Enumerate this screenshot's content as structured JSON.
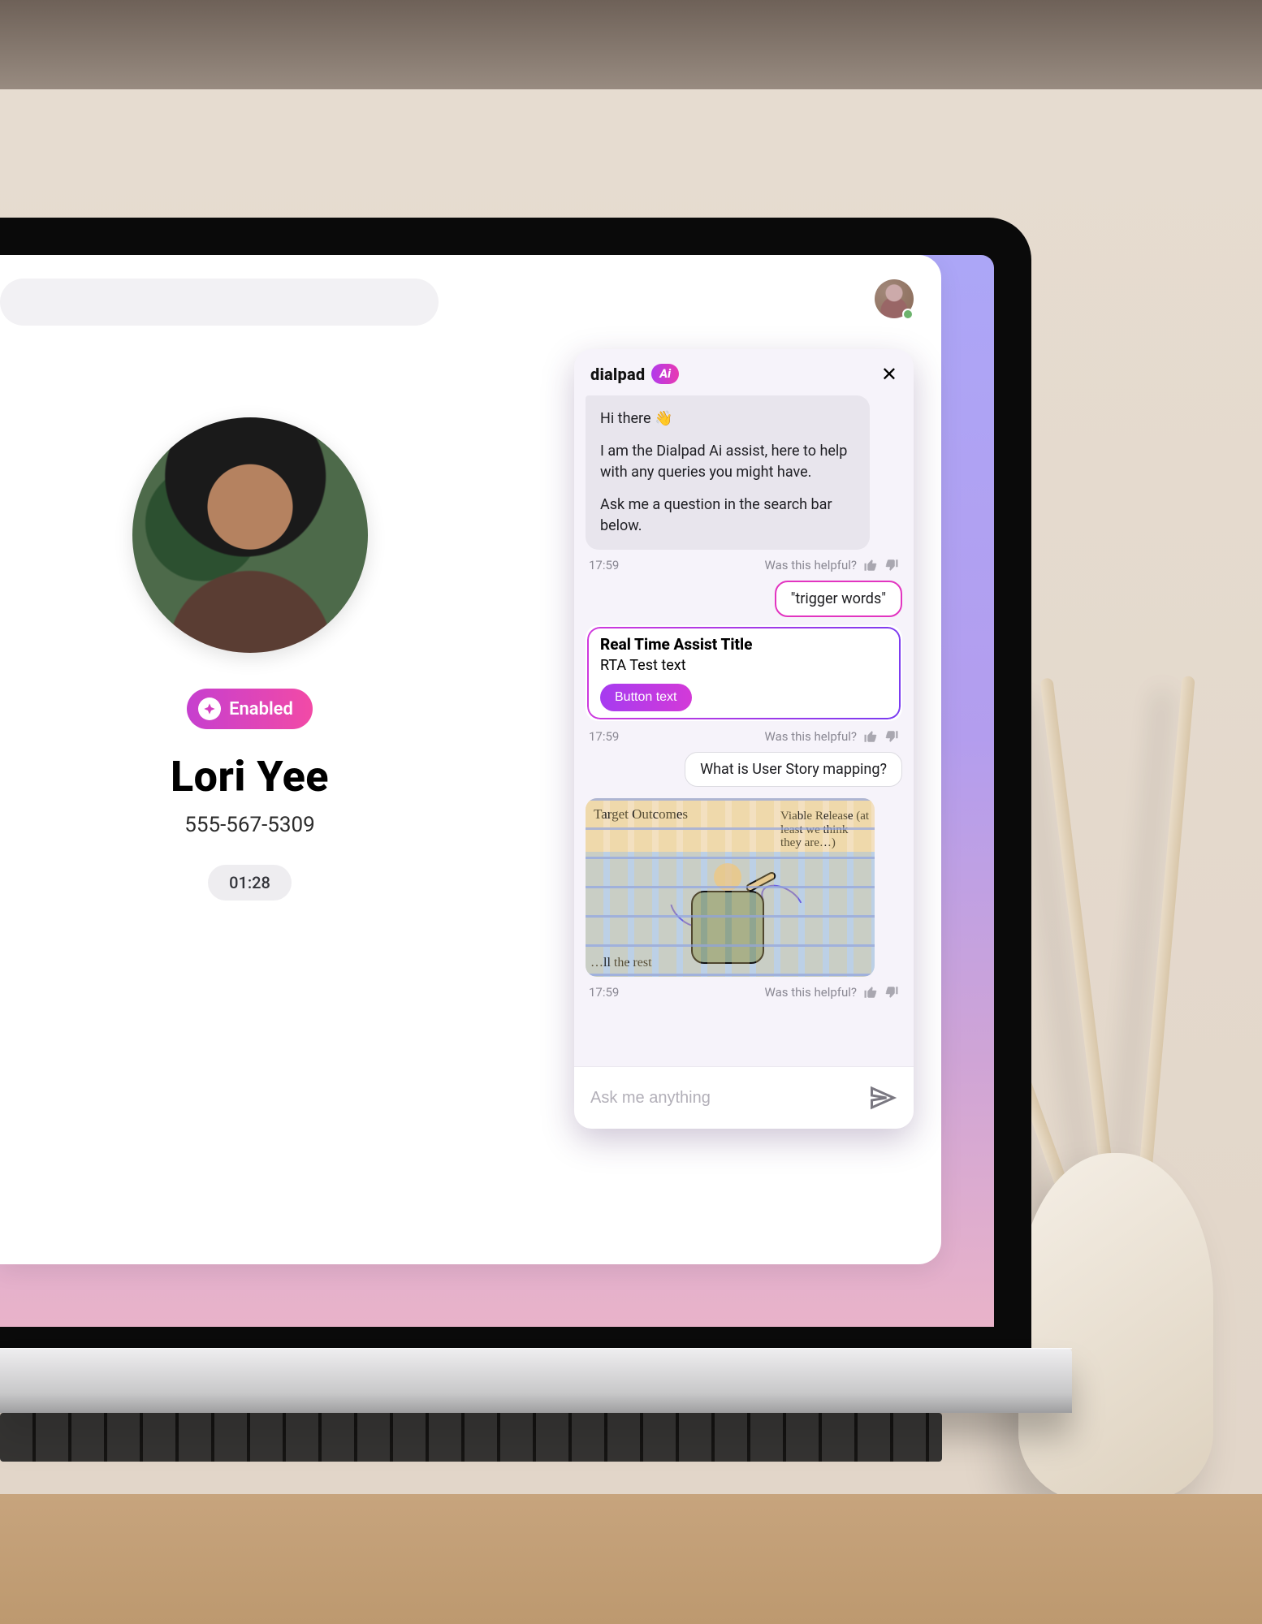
{
  "header": {
    "brand_word": "dialpad",
    "brand_ai": "Ai"
  },
  "contact": {
    "pill_label": "Enabled",
    "name": "Lori Yee",
    "phone": "555-567-5309",
    "timer": "01:28"
  },
  "assistant": {
    "greeting": "Hi there 👋",
    "intro": "I am the Dialpad Ai assist, here to help with any queries you might have.",
    "prompt": "Ask me a question in the search bar below.",
    "helpful_label": "Was this helpful?",
    "ts1": "17:59",
    "trigger": "\"trigger words\"",
    "rta_title": "Real Time Assist Title",
    "rta_text": "RTA Test text",
    "rta_button": "Button text",
    "ts2": "17:59",
    "user_q": "What is User Story mapping?",
    "ts3": "17:59",
    "input_placeholder": "Ask me anything"
  },
  "illus": {
    "note1": "Target Outcomes",
    "note2": "Viable Release (at least we think they are…)",
    "note3": "…ll the rest"
  }
}
